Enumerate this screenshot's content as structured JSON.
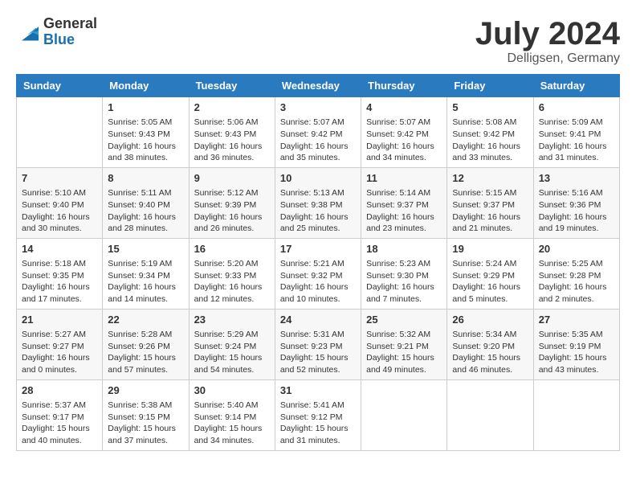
{
  "logo": {
    "general": "General",
    "blue": "Blue"
  },
  "title": "July 2024",
  "location": "Delligsen, Germany",
  "days_header": [
    "Sunday",
    "Monday",
    "Tuesday",
    "Wednesday",
    "Thursday",
    "Friday",
    "Saturday"
  ],
  "weeks": [
    [
      {
        "num": "",
        "info": ""
      },
      {
        "num": "1",
        "info": "Sunrise: 5:05 AM\nSunset: 9:43 PM\nDaylight: 16 hours\nand 38 minutes."
      },
      {
        "num": "2",
        "info": "Sunrise: 5:06 AM\nSunset: 9:43 PM\nDaylight: 16 hours\nand 36 minutes."
      },
      {
        "num": "3",
        "info": "Sunrise: 5:07 AM\nSunset: 9:42 PM\nDaylight: 16 hours\nand 35 minutes."
      },
      {
        "num": "4",
        "info": "Sunrise: 5:07 AM\nSunset: 9:42 PM\nDaylight: 16 hours\nand 34 minutes."
      },
      {
        "num": "5",
        "info": "Sunrise: 5:08 AM\nSunset: 9:42 PM\nDaylight: 16 hours\nand 33 minutes."
      },
      {
        "num": "6",
        "info": "Sunrise: 5:09 AM\nSunset: 9:41 PM\nDaylight: 16 hours\nand 31 minutes."
      }
    ],
    [
      {
        "num": "7",
        "info": "Sunrise: 5:10 AM\nSunset: 9:40 PM\nDaylight: 16 hours\nand 30 minutes."
      },
      {
        "num": "8",
        "info": "Sunrise: 5:11 AM\nSunset: 9:40 PM\nDaylight: 16 hours\nand 28 minutes."
      },
      {
        "num": "9",
        "info": "Sunrise: 5:12 AM\nSunset: 9:39 PM\nDaylight: 16 hours\nand 26 minutes."
      },
      {
        "num": "10",
        "info": "Sunrise: 5:13 AM\nSunset: 9:38 PM\nDaylight: 16 hours\nand 25 minutes."
      },
      {
        "num": "11",
        "info": "Sunrise: 5:14 AM\nSunset: 9:37 PM\nDaylight: 16 hours\nand 23 minutes."
      },
      {
        "num": "12",
        "info": "Sunrise: 5:15 AM\nSunset: 9:37 PM\nDaylight: 16 hours\nand 21 minutes."
      },
      {
        "num": "13",
        "info": "Sunrise: 5:16 AM\nSunset: 9:36 PM\nDaylight: 16 hours\nand 19 minutes."
      }
    ],
    [
      {
        "num": "14",
        "info": "Sunrise: 5:18 AM\nSunset: 9:35 PM\nDaylight: 16 hours\nand 17 minutes."
      },
      {
        "num": "15",
        "info": "Sunrise: 5:19 AM\nSunset: 9:34 PM\nDaylight: 16 hours\nand 14 minutes."
      },
      {
        "num": "16",
        "info": "Sunrise: 5:20 AM\nSunset: 9:33 PM\nDaylight: 16 hours\nand 12 minutes."
      },
      {
        "num": "17",
        "info": "Sunrise: 5:21 AM\nSunset: 9:32 PM\nDaylight: 16 hours\nand 10 minutes."
      },
      {
        "num": "18",
        "info": "Sunrise: 5:23 AM\nSunset: 9:30 PM\nDaylight: 16 hours\nand 7 minutes."
      },
      {
        "num": "19",
        "info": "Sunrise: 5:24 AM\nSunset: 9:29 PM\nDaylight: 16 hours\nand 5 minutes."
      },
      {
        "num": "20",
        "info": "Sunrise: 5:25 AM\nSunset: 9:28 PM\nDaylight: 16 hours\nand 2 minutes."
      }
    ],
    [
      {
        "num": "21",
        "info": "Sunrise: 5:27 AM\nSunset: 9:27 PM\nDaylight: 16 hours\nand 0 minutes."
      },
      {
        "num": "22",
        "info": "Sunrise: 5:28 AM\nSunset: 9:26 PM\nDaylight: 15 hours\nand 57 minutes."
      },
      {
        "num": "23",
        "info": "Sunrise: 5:29 AM\nSunset: 9:24 PM\nDaylight: 15 hours\nand 54 minutes."
      },
      {
        "num": "24",
        "info": "Sunrise: 5:31 AM\nSunset: 9:23 PM\nDaylight: 15 hours\nand 52 minutes."
      },
      {
        "num": "25",
        "info": "Sunrise: 5:32 AM\nSunset: 9:21 PM\nDaylight: 15 hours\nand 49 minutes."
      },
      {
        "num": "26",
        "info": "Sunrise: 5:34 AM\nSunset: 9:20 PM\nDaylight: 15 hours\nand 46 minutes."
      },
      {
        "num": "27",
        "info": "Sunrise: 5:35 AM\nSunset: 9:19 PM\nDaylight: 15 hours\nand 43 minutes."
      }
    ],
    [
      {
        "num": "28",
        "info": "Sunrise: 5:37 AM\nSunset: 9:17 PM\nDaylight: 15 hours\nand 40 minutes."
      },
      {
        "num": "29",
        "info": "Sunrise: 5:38 AM\nSunset: 9:15 PM\nDaylight: 15 hours\nand 37 minutes."
      },
      {
        "num": "30",
        "info": "Sunrise: 5:40 AM\nSunset: 9:14 PM\nDaylight: 15 hours\nand 34 minutes."
      },
      {
        "num": "31",
        "info": "Sunrise: 5:41 AM\nSunset: 9:12 PM\nDaylight: 15 hours\nand 31 minutes."
      },
      {
        "num": "",
        "info": ""
      },
      {
        "num": "",
        "info": ""
      },
      {
        "num": "",
        "info": ""
      }
    ]
  ]
}
